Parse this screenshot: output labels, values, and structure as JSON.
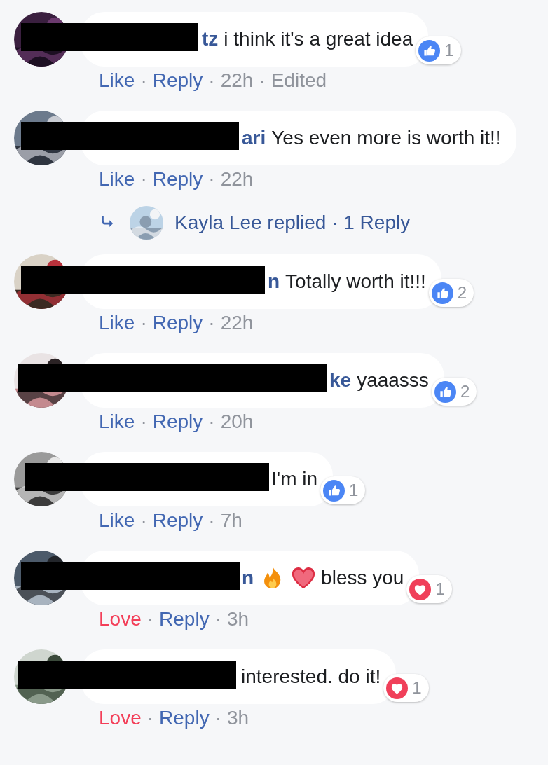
{
  "separator": "·",
  "comments": [
    {
      "redacted": true,
      "author_visible": "tz",
      "text": "i think it's a great idea",
      "reaction": {
        "kind": "like",
        "count": "1"
      },
      "react": {
        "label": "Like",
        "kind": "like"
      },
      "reply": "Reply",
      "time": "22h",
      "edited": "Edited"
    },
    {
      "redacted": true,
      "author_visible": "ari",
      "text": "Yes even more is worth it!!",
      "react": {
        "label": "Like",
        "kind": "like"
      },
      "reply": "Reply",
      "time": "22h",
      "replies": {
        "name": "Kayla Lee",
        "verb": "replied",
        "count": "1 Reply"
      }
    },
    {
      "redacted": true,
      "author_visible": "n",
      "text": "Totally worth it!!!",
      "reaction": {
        "kind": "like",
        "count": "2"
      },
      "react": {
        "label": "Like",
        "kind": "like"
      },
      "reply": "Reply",
      "time": "22h"
    },
    {
      "redacted": true,
      "author_visible": "ke",
      "text": "yaaasss",
      "reaction": {
        "kind": "like",
        "count": "2"
      },
      "react": {
        "label": "Like",
        "kind": "like"
      },
      "reply": "Reply",
      "time": "20h"
    },
    {
      "redacted": true,
      "text": "I'm in",
      "reaction": {
        "kind": "like",
        "count": "1"
      },
      "react": {
        "label": "Like",
        "kind": "like"
      },
      "reply": "Reply",
      "time": "7h"
    },
    {
      "redacted": true,
      "author_visible": "n",
      "emoji": [
        {
          "kind": "fire"
        },
        {
          "kind": "heart"
        }
      ],
      "text": "bless you",
      "reaction": {
        "kind": "love",
        "count": "1"
      },
      "react": {
        "label": "Love",
        "kind": "love"
      },
      "reply": "Reply",
      "time": "3h"
    },
    {
      "redacted": true,
      "text": "interested. do it!",
      "reaction": {
        "kind": "love",
        "count": "1"
      },
      "react": {
        "label": "Love",
        "kind": "love"
      },
      "reply": "Reply",
      "time": "3h"
    }
  ]
}
